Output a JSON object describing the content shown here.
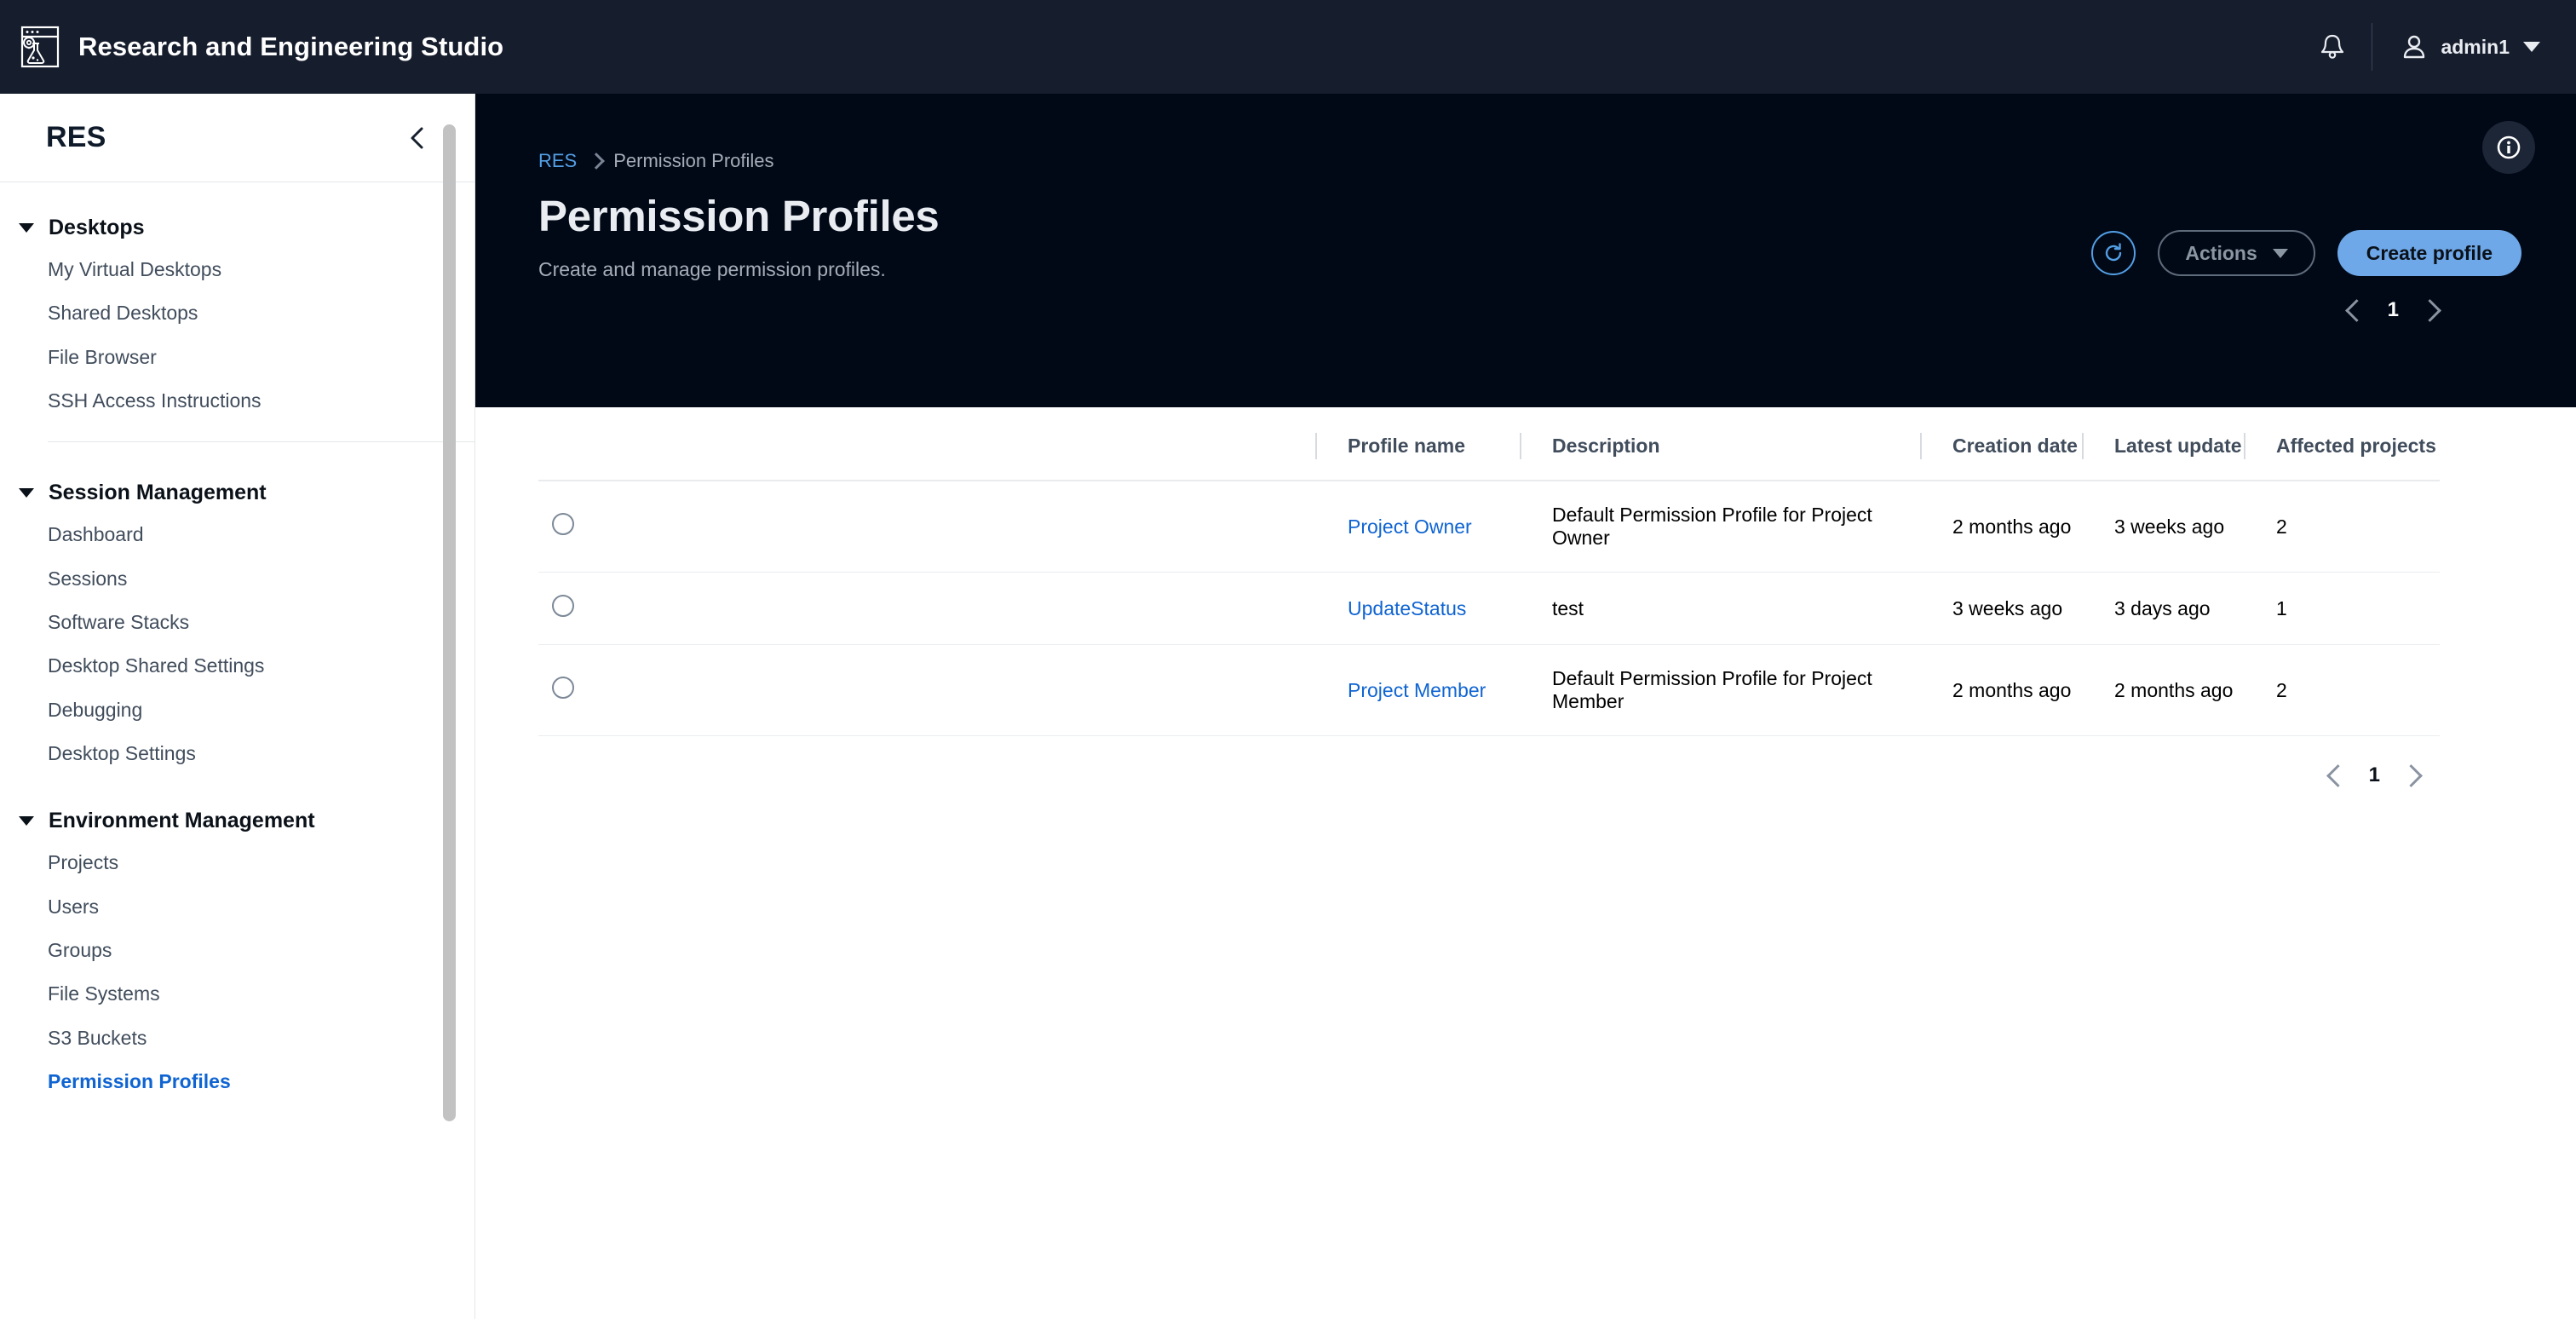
{
  "topnav": {
    "app_title": "Research and Engineering Studio",
    "logo_icon": "res-browser-flask-gear-logo",
    "bell_icon": "notifications-bell-icon",
    "user_icon": "user-avatar-icon",
    "user_name": "admin1",
    "caret_icon": "chevron-down-icon"
  },
  "sidebar": {
    "title": "RES",
    "collapse_icon": "chevron-left-icon",
    "groups": [
      {
        "label": "Desktops",
        "items": [
          "My Virtual Desktops",
          "Shared Desktops",
          "File Browser",
          "SSH Access Instructions"
        ]
      },
      {
        "label": "Session Management",
        "items": [
          "Dashboard",
          "Sessions",
          "Software Stacks",
          "Desktop Shared Settings",
          "Debugging",
          "Desktop Settings"
        ]
      },
      {
        "label": "Environment Management",
        "items": [
          "Projects",
          "Users",
          "Groups",
          "File Systems",
          "S3 Buckets",
          "Permission Profiles"
        ]
      }
    ],
    "active_item": "Permission Profiles"
  },
  "header": {
    "breadcrumb_root": "RES",
    "breadcrumb_current": "Permission Profiles",
    "title": "Permission Profiles",
    "subtitle": "Create and manage permission profiles.",
    "refresh_icon": "refresh-icon",
    "actions_label": "Actions",
    "create_label": "Create profile",
    "info_icon": "info-circle-icon"
  },
  "pagination": {
    "prev_icon": "chevron-left-icon",
    "next_icon": "chevron-right-icon",
    "current_page": "1"
  },
  "table": {
    "columns": [
      "Profile name",
      "Description",
      "Creation date",
      "Latest update",
      "Affected projects"
    ],
    "rows": [
      {
        "name": "Project Owner",
        "description": "Default Permission Profile for Project Owner",
        "creation_date": "2 months ago",
        "latest_update": "3 weeks ago",
        "affected_projects": "2"
      },
      {
        "name": "UpdateStatus",
        "description": "test",
        "creation_date": "3 weeks ago",
        "latest_update": "3 days ago",
        "affected_projects": "1"
      },
      {
        "name": "Project Member",
        "description": "Default Permission Profile for Project Member",
        "creation_date": "2 months ago",
        "latest_update": "2 months ago",
        "affected_projects": "2"
      }
    ]
  },
  "colors": {
    "topnav_bg": "#161d2d",
    "page_header_bg": "#010917",
    "accent_link": "#0f64d2",
    "accent_button": "#6ea8e8",
    "breadcrumb_link": "#539fe5"
  }
}
